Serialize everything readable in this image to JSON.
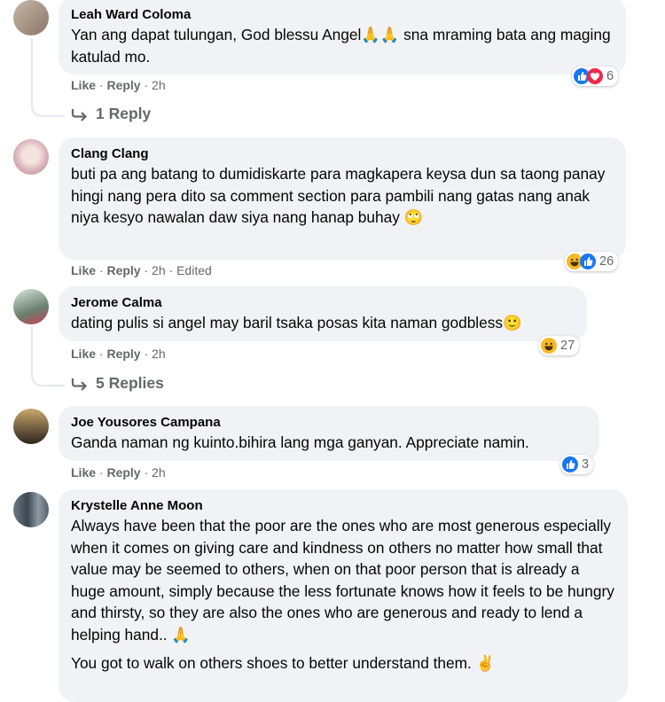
{
  "comments": [
    {
      "author": "Leah Ward Coloma",
      "text": "Yan ang dapat tulungan, God blessu Angel🙏🙏 sna mraming bata ang maging katulad mo.",
      "like": "Like",
      "reply": "Reply",
      "time": "2h",
      "reaction_count": "6",
      "reactions": [
        "like-icon",
        "love-icon"
      ],
      "replies_label": "1 Reply"
    },
    {
      "author": "Clang Clang",
      "text": "buti pa ang batang to dumidiskarte para magkapera keysa dun sa taong panay hingi nang pera dito sa comment section para pambili nang gatas nang anak niya kesyo nawalan daw siya nang hanap buhay 🙄",
      "like": "Like",
      "reply": "Reply",
      "time": "2h",
      "edited": "Edited",
      "reaction_count": "26",
      "reactions": [
        "haha-icon",
        "like-icon"
      ]
    },
    {
      "author": "Jerome Calma",
      "text": "dating pulis si angel may baril tsaka posas kita naman godbless🙂",
      "like": "Like",
      "reply": "Reply",
      "time": "2h",
      "reaction_count": "27",
      "reactions": [
        "haha-icon"
      ],
      "replies_label": "5 Replies"
    },
    {
      "author": "Joe Yousores Campana",
      "text": "Ganda naman ng kuinto.bihira lang mga ganyan. Appreciate namin.",
      "like": "Like",
      "reply": "Reply",
      "time": "2h",
      "reaction_count": "3",
      "reactions": [
        "like-icon"
      ]
    },
    {
      "author": "Krystelle Anne Moon",
      "text": "Always have been that the poor are the ones who are most generous especially when it comes on giving care and kindness on others no matter how small that value may be seemed to others, when on that poor person that is already a huge amount, simply because the less fortunate knows how it feels to be hungry and thirsty, so they are also the ones who are generous and ready to lend a helping hand.. 🙏",
      "text2": "You got to walk on others shoes to better understand them. ✌"
    }
  ],
  "colors": {
    "bubble": "#f0f2f5",
    "meta": "#65676b",
    "like_blue": "#1877f2",
    "love_red": "#f02849",
    "haha_yellow": "#f7b928"
  }
}
